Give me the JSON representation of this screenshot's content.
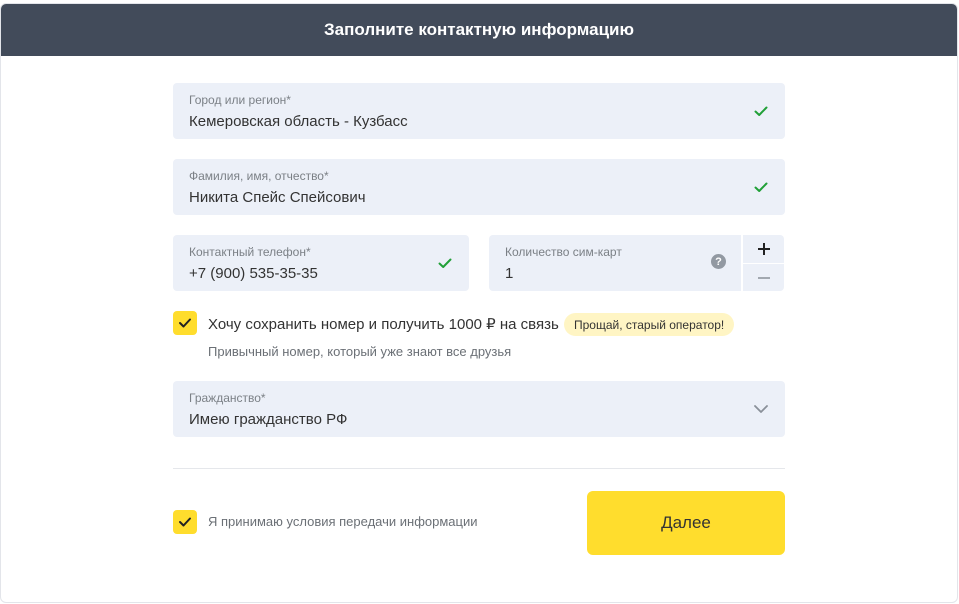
{
  "header": {
    "title": "Заполните контактную информацию"
  },
  "form": {
    "region": {
      "label": "Город или регион*",
      "value": "Кемеровская область - Кузбасс"
    },
    "fullname": {
      "label": "Фамилия, имя, отчество*",
      "value": "Никита Спейс Спейсович"
    },
    "phone": {
      "label": "Контактный телефон*",
      "value": "+7 (900) 535-35-35"
    },
    "sim_count": {
      "label": "Количество сим-карт",
      "value": "1",
      "plus": "+",
      "minus": "−",
      "help": "?"
    },
    "keep_number": {
      "label": "Хочу сохранить номер и получить 1000 ₽ на связь",
      "badge": "Прощай, старый оператор!",
      "hint": "Привычный номер, который уже знают все друзья",
      "checked": true
    },
    "citizenship": {
      "label": "Гражданство*",
      "value": "Имею гражданство РФ"
    },
    "terms": {
      "label": "Я принимаю условия передачи информации",
      "checked": true
    },
    "next_button": "Далее"
  },
  "colors": {
    "header_bg": "#424b5a",
    "field_bg": "#ecf0f8",
    "accent_yellow": "#ffdd2d",
    "valid_green": "#21a038"
  },
  "icons": [
    "check-icon",
    "help-icon",
    "chevron-down-icon",
    "plus-icon",
    "minus-icon",
    "checkbox-check-icon"
  ]
}
